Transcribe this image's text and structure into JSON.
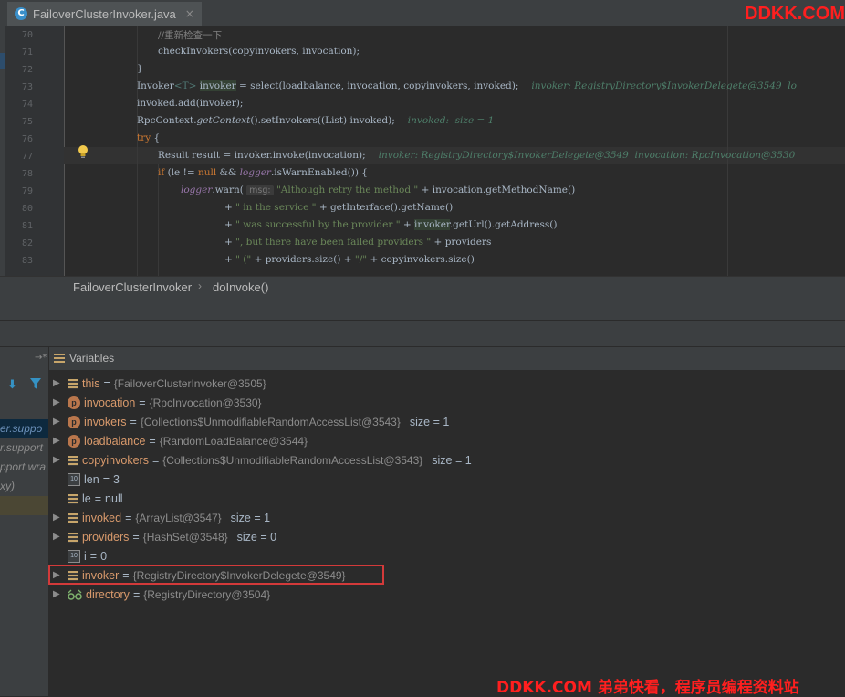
{
  "editor": {
    "tab_label": "FailoverClusterInvoker.java",
    "tab_icon_letter": "C",
    "tab_close": "×",
    "line_numbers": [
      "70",
      "71",
      "72",
      "73",
      "74",
      "75",
      "76",
      "77",
      "78",
      "79",
      "80",
      "81",
      "82",
      "83"
    ],
    "breadcrumb": [
      "FailoverClusterInvoker",
      "doInvoke()"
    ],
    "breadcrumb_sep": "›"
  },
  "code": {
    "l70_comment": "//重新检查一下",
    "l71_call": "checkInvokers(copyinvokers, invocation);",
    "l72_brace": "}",
    "l73_type": "Invoker",
    "l73_gen": "<T>",
    "l73_var": "invoker",
    "l73_rest": " = select(loadbalance, invocation, copyinvokers, invoked);",
    "l73_hint": "invoker: RegistryDirectory$InvokerDelegete@3549  lo",
    "l74_call": "invoked.add(invoker);",
    "l75_a": "RpcContext.",
    "l75_static": "getContext",
    "l75_b": "().setInvokers((List) invoked);",
    "l75_hint": "invoked:  size = 1",
    "l76_try": "try",
    "l76_brace": " {",
    "l77_code": "Result result = invoker.invoke(invocation);",
    "l77_hint": "invoker: RegistryDirectory$InvokerDelegete@3549  invocation: RpcInvocation@3530",
    "l78_if": "if",
    "l78_a": " (le != ",
    "l78_null": "null",
    "l78_b": " && ",
    "l78_logger": "logger",
    "l78_c": ".isWarnEnabled()) {",
    "l79_logger": "logger",
    "l79_a": ".warn(",
    "l79_param": "msg:",
    "l79_str": "\"Although retry the method \"",
    "l79_b": " + invocation.getMethodName()",
    "l80_plus": "+ ",
    "l80_str": "\" in the service \"",
    "l80_b": " + getInterface().getName()",
    "l81_plus": "+ ",
    "l81_str": "\" was successful by the provider \"",
    "l81_b": " + ",
    "l81_var": "invoker",
    "l81_c": ".getUrl().getAddress()",
    "l82_plus": "+ ",
    "l82_str": "\", but there have been failed providers \"",
    "l82_b": " + providers",
    "l83_plus": "+ ",
    "l83_str1": "\" (\"",
    "l83_b": " + providers.size() + ",
    "l83_str2": "\"/\"",
    "l83_c": " + copyinvokers.size()"
  },
  "debug": {
    "variables_title": "Variables",
    "frames": [
      {
        "text": "er.suppo"
      },
      {
        "text": "r.support"
      },
      {
        "text": "pport.wra"
      },
      {
        "text": "xy)"
      }
    ],
    "variables": [
      {
        "name": "this",
        "value": "{FailoverClusterInvoker@3505}",
        "extra": "",
        "icon": "field"
      },
      {
        "name": "invocation",
        "value": "{RpcInvocation@3530}",
        "extra": "",
        "icon": "p"
      },
      {
        "name": "invokers",
        "value": "{Collections$UnmodifiableRandomAccessList@3543}",
        "extra": "size = 1",
        "icon": "p"
      },
      {
        "name": "loadbalance",
        "value": "{RandomLoadBalance@3544}",
        "extra": "",
        "icon": "p"
      },
      {
        "name": "copyinvokers",
        "value": "{Collections$UnmodifiableRandomAccessList@3543}",
        "extra": "size = 1",
        "icon": "field"
      },
      {
        "name": "len",
        "value": "3",
        "extra": "",
        "icon": "prim"
      },
      {
        "name": "le",
        "value": "null",
        "extra": "",
        "icon": "field"
      },
      {
        "name": "invoked",
        "value": "{ArrayList@3547}",
        "extra": "size = 1",
        "icon": "field"
      },
      {
        "name": "providers",
        "value": "{HashSet@3548}",
        "extra": "size = 0",
        "icon": "field"
      },
      {
        "name": "i",
        "value": "0",
        "extra": "",
        "icon": "prim"
      },
      {
        "name": "invoker",
        "value": "{RegistryDirectory$InvokerDelegete@3549}",
        "extra": "",
        "icon": "field"
      },
      {
        "name": "directory",
        "value": "{RegistryDirectory@3504}",
        "extra": "",
        "icon": "glasses"
      }
    ],
    "eq": "="
  },
  "watermark": {
    "top": "DDKK.COM",
    "bottom": "DDKK.COM 弟弟快看，程序员编程资料站"
  },
  "colors": {
    "editor_bg": "#2b2b2b",
    "panel_bg": "#3c3f41",
    "keyword": "#cc7832",
    "string": "#6a8759",
    "highlight_box": "#d33a3a",
    "watermark": "#ff1f1f"
  },
  "icons": [
    "class-c-icon",
    "close-icon",
    "lightbulb-icon",
    "down-arrow-icon",
    "filter-icon",
    "restore-icon",
    "variables-icon",
    "expand-triangle-icon",
    "field-icon",
    "parameter-icon",
    "primitive-icon",
    "watch-glasses-icon"
  ]
}
